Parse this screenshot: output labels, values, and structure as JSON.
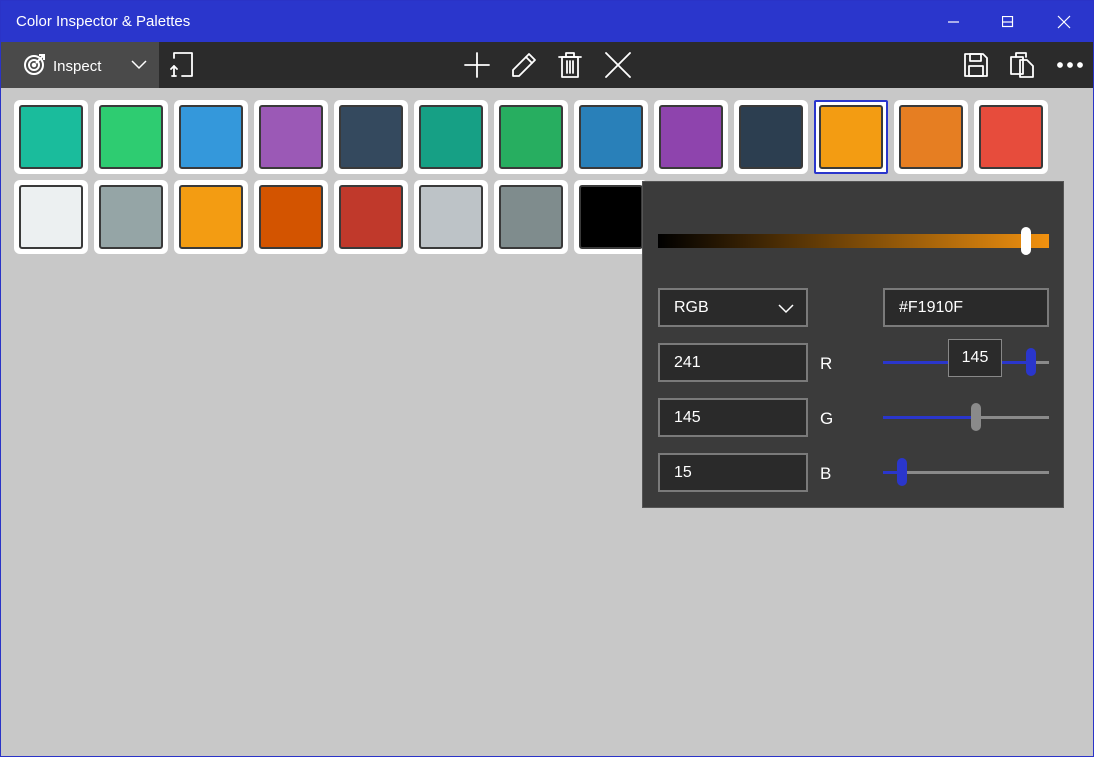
{
  "window": {
    "title": "Color Inspector & Palettes"
  },
  "toolbar": {
    "mode_label": "Inspect",
    "icons": [
      "inspect-target-icon",
      "chevron-down-icon",
      "crop-export-icon",
      "add-icon",
      "edit-pencil-icon",
      "delete-trash-icon",
      "close-x-icon",
      "save-icon",
      "copy-icon",
      "more-icon"
    ]
  },
  "palette": {
    "row1": [
      "#1abc9c",
      "#2ecc71",
      "#3498db",
      "#9b59b6",
      "#34495e",
      "#16a085",
      "#27ae60",
      "#2980b9",
      "#8e44ad",
      "#2c3e50",
      "#f39c12",
      "#e67e22",
      "#e74c3c"
    ],
    "row2": [
      "#ecf0f1",
      "#95a5a6",
      "#f39c12",
      "#d35400",
      "#c0392b",
      "#bdc3c7",
      "#7f8c8d",
      "#000000"
    ],
    "selected_index": 10
  },
  "editor": {
    "alpha_value": 0.94,
    "mode": "RGB",
    "hex": "#F1910F",
    "channels": [
      {
        "label": "R",
        "value": "241",
        "level": 241
      },
      {
        "label": "G",
        "value": "145",
        "level": 145
      },
      {
        "label": "B",
        "value": "15",
        "level": 15
      }
    ],
    "tooltip": "145",
    "accent": "#2a36cc"
  }
}
